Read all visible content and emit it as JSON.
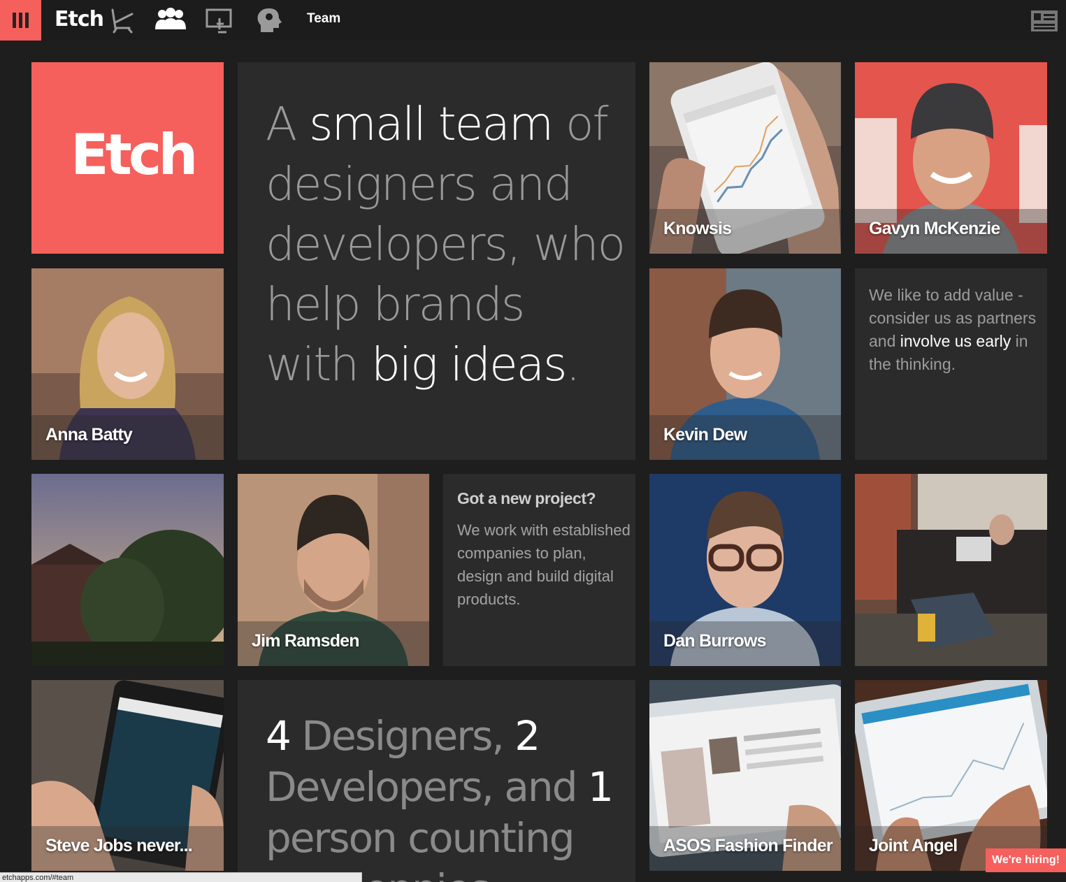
{
  "nav": {
    "brand": "Etch",
    "title": "Team",
    "icons": [
      "menu-icon",
      "chair-icon",
      "team-icon",
      "touch-screen-icon",
      "idea-head-icon",
      "contact-card-icon"
    ]
  },
  "tiles": {
    "logo_text": "Etch",
    "hero": {
      "w1": "A",
      "w2": "small team",
      "w3": "of",
      "w4": "designers and developers, who help brands with",
      "w5": "big ideas",
      "w6": "."
    },
    "knowsis": "Knowsis",
    "gavyn": "Gavyn McKenzie",
    "anna": "Anna Batty",
    "kevin": "Kevin Dew",
    "value": {
      "p1": "We like to add value - consider us as partners and ",
      "p2": "involve us early",
      "p3": " in the thinking."
    },
    "jim": "Jim Ramsden",
    "project": {
      "title": "Got a new project?",
      "body": "We work with established companies to plan, design and build digital products."
    },
    "dan": "Dan Burrows",
    "steve": "Steve Jobs never...",
    "stats": {
      "n1": "4",
      "t1": " Designers, ",
      "n2": "2",
      "t2": " Developers, and ",
      "n3": "1",
      "t3": " person counting the pennies"
    },
    "asos": "ASOS Fashion Finder",
    "joint": "Joint Angel"
  },
  "hiring_label": "We're hiring!",
  "status_url": "etchapps.com/#team",
  "colors": {
    "accent": "#f5605c",
    "background": "#1e1e1e",
    "tile": "#2b2b2b"
  }
}
